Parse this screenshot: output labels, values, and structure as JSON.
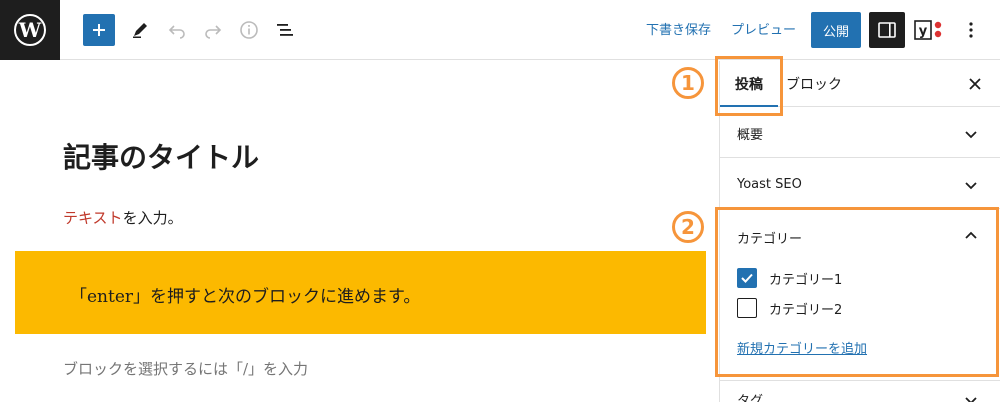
{
  "toolbar": {
    "save_draft": "下書き保存",
    "preview": "プレビュー",
    "publish": "公開",
    "icons": [
      "wordpress-logo",
      "add",
      "edit-pen",
      "undo",
      "redo",
      "info",
      "list-view",
      "settings-panel",
      "yoast",
      "more-vertical"
    ]
  },
  "editor": {
    "title": "記事のタイトル",
    "paragraph_red": "テキスト",
    "paragraph_rest": "を入力。",
    "callout": "「enter」を押すと次のブロックに進めます。",
    "placeholder": "ブロックを選択するには「/」を入力",
    "callout_color": "#fcb900"
  },
  "sidebar": {
    "tab_post": "投稿",
    "tab_block": "ブロック",
    "panels": {
      "summary": "概要",
      "yoast": "Yoast SEO",
      "categories": "カテゴリー",
      "tags": "タグ"
    },
    "categories": [
      {
        "label": "カテゴリー1",
        "checked": true
      },
      {
        "label": "カテゴリー2",
        "checked": false
      }
    ],
    "add_category": "新規カテゴリーを追加"
  },
  "annotations": {
    "marker_1": "①",
    "marker_2": "②",
    "color": "#f6953b"
  },
  "colors": {
    "accent": "#2271b1",
    "dark": "#1e1e1e"
  }
}
